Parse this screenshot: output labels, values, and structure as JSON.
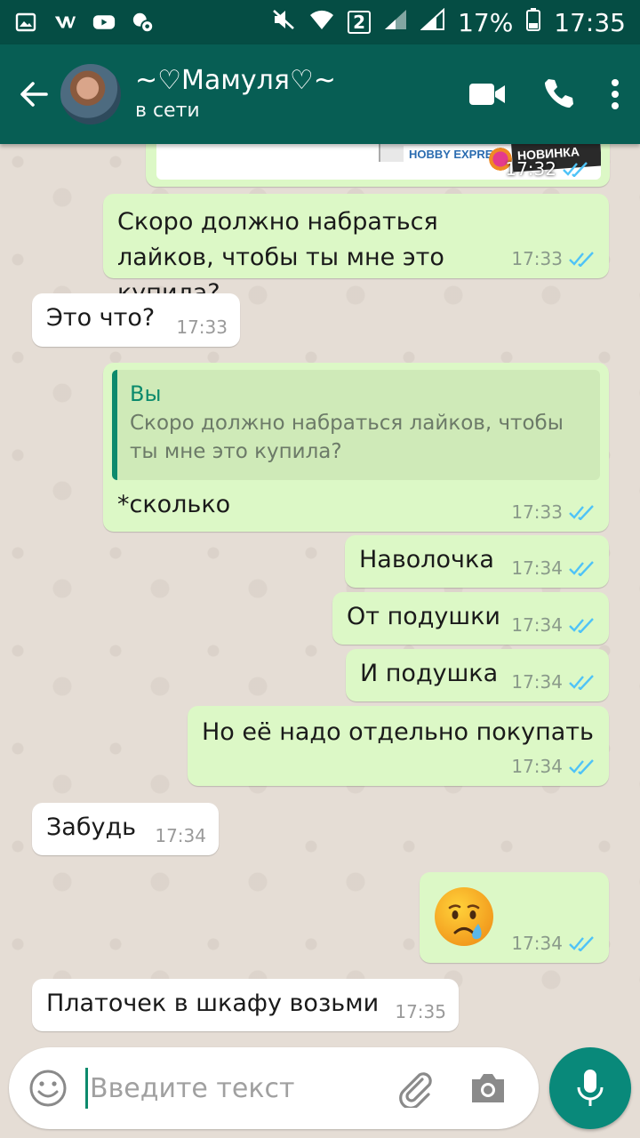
{
  "status_bar": {
    "sim": "2",
    "battery": "17%",
    "time": "17:35"
  },
  "header": {
    "contact_name": "~♡Мамуля♡~",
    "status": "в сети"
  },
  "messages": [
    {
      "dir": "out",
      "text": "Скоро должно набраться  лайков, чтобы ты мне это купила?",
      "time": "17:33"
    },
    {
      "dir": "in",
      "text": "Это что?",
      "time": "17:33"
    },
    {
      "dir": "out",
      "reply_author": "Вы",
      "reply_text": "Скоро должно набраться  лайков, чтобы ты мне это купила?",
      "text": "*сколько",
      "time": "17:33"
    },
    {
      "dir": "out",
      "text": "Наволочка",
      "time": "17:34"
    },
    {
      "dir": "out",
      "text": "От подушки",
      "time": "17:34"
    },
    {
      "dir": "out",
      "text": "И подушка",
      "time": "17:34"
    },
    {
      "dir": "out",
      "text": "Но её надо отдельно покупать",
      "time": "17:34"
    },
    {
      "dir": "in",
      "text": "Забудь",
      "time": "17:34"
    },
    {
      "dir": "out",
      "text": "😢",
      "time": "17:34"
    },
    {
      "dir": "in",
      "text": "Платочек в шкафу возьми",
      "time": "17:35"
    }
  ],
  "image_message": {
    "banner_text": "HOBBY EXPRESS",
    "corner_text": "НОВИНКА",
    "time": "17:32"
  },
  "input": {
    "placeholder": "Введите текст"
  },
  "colors": {
    "header": "#075e54",
    "status_bar": "#054d44",
    "outgoing_bubble": "#dcf8c6",
    "incoming_bubble": "#ffffff",
    "read_ticks": "#4fc3f7",
    "mic_button": "#09897a"
  },
  "icons": {
    "back": "arrow-left-icon",
    "video": "video-camera-icon",
    "call": "phone-icon",
    "menu": "more-vertical-icon",
    "emoji": "smiley-icon",
    "attach": "paperclip-icon",
    "camera": "camera-icon",
    "mic": "microphone-icon",
    "read": "double-check-icon"
  }
}
